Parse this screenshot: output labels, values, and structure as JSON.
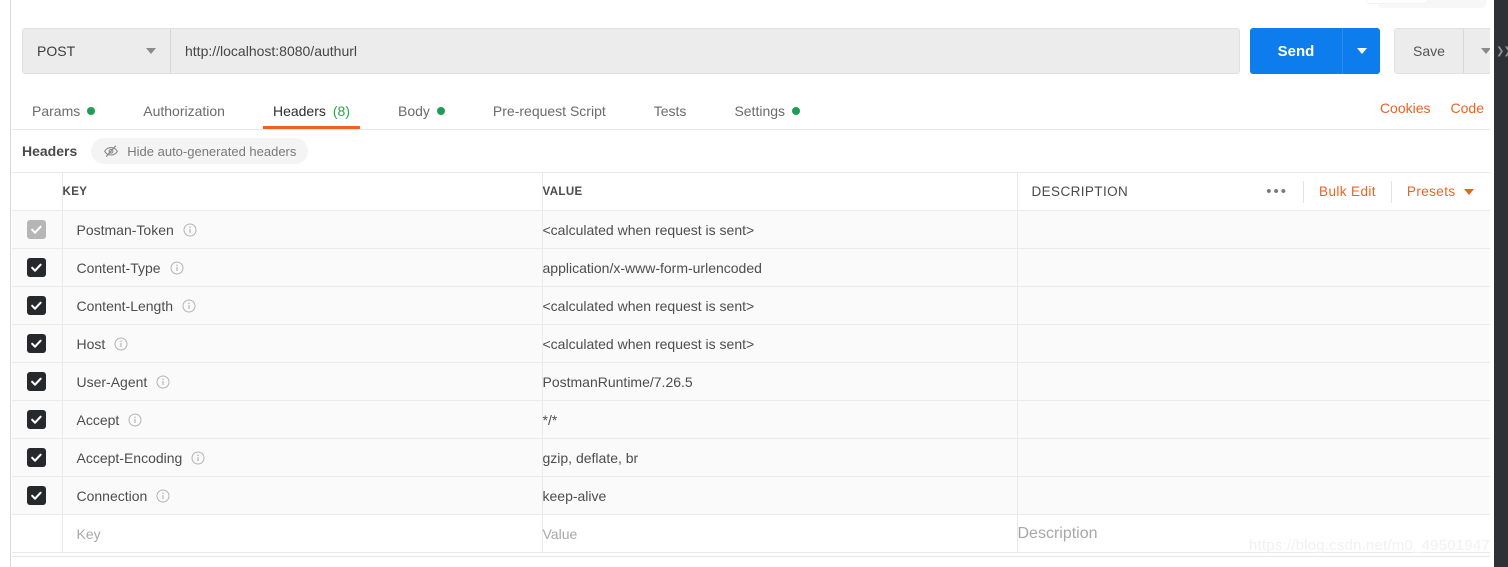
{
  "request_bar": {
    "method": "POST",
    "url": "http://localhost:8080/authurl",
    "send_label": "Send",
    "save_label": "Save",
    "accent_blue": "#0d7ded",
    "accent_orange": "#ef6123"
  },
  "tabs": [
    {
      "label": "Params",
      "dot": true,
      "count": "",
      "active": false
    },
    {
      "label": "Authorization",
      "dot": false,
      "count": "",
      "active": false
    },
    {
      "label": "Headers",
      "dot": false,
      "count": "(8)",
      "active": true
    },
    {
      "label": "Body",
      "dot": true,
      "count": "",
      "active": false
    },
    {
      "label": "Pre-request Script",
      "dot": false,
      "count": "",
      "active": false
    },
    {
      "label": "Tests",
      "dot": false,
      "count": "",
      "active": false
    },
    {
      "label": "Settings",
      "dot": true,
      "count": "",
      "active": false
    }
  ],
  "tabs_right": {
    "cookies": "Cookies",
    "code": "Code"
  },
  "subbar": {
    "title": "Headers",
    "toggle_label": "Hide auto-generated headers"
  },
  "table": {
    "headers": {
      "key": "KEY",
      "value": "VALUE",
      "description": "DESCRIPTION"
    },
    "actions": {
      "more": "•••",
      "bulk_edit": "Bulk Edit",
      "presets": "Presets"
    },
    "rows": [
      {
        "checked": true,
        "muted": true,
        "key": "Postman-Token",
        "value": "<calculated when request is sent>",
        "description": ""
      },
      {
        "checked": true,
        "muted": false,
        "key": "Content-Type",
        "value": "application/x-www-form-urlencoded",
        "description": ""
      },
      {
        "checked": true,
        "muted": false,
        "key": "Content-Length",
        "value": "<calculated when request is sent>",
        "description": ""
      },
      {
        "checked": true,
        "muted": false,
        "key": "Host",
        "value": "<calculated when request is sent>",
        "description": ""
      },
      {
        "checked": true,
        "muted": false,
        "key": "User-Agent",
        "value": "PostmanRuntime/7.26.5",
        "description": ""
      },
      {
        "checked": true,
        "muted": false,
        "key": "Accept",
        "value": "*/*",
        "description": ""
      },
      {
        "checked": true,
        "muted": false,
        "key": "Accept-Encoding",
        "value": "gzip, deflate, br",
        "description": ""
      },
      {
        "checked": true,
        "muted": false,
        "key": "Connection",
        "value": "keep-alive",
        "description": ""
      }
    ],
    "placeholders": {
      "key": "Key",
      "value": "Value",
      "description": "Description"
    }
  },
  "watermark": "https://blog.csdn.net/m0_49501947"
}
